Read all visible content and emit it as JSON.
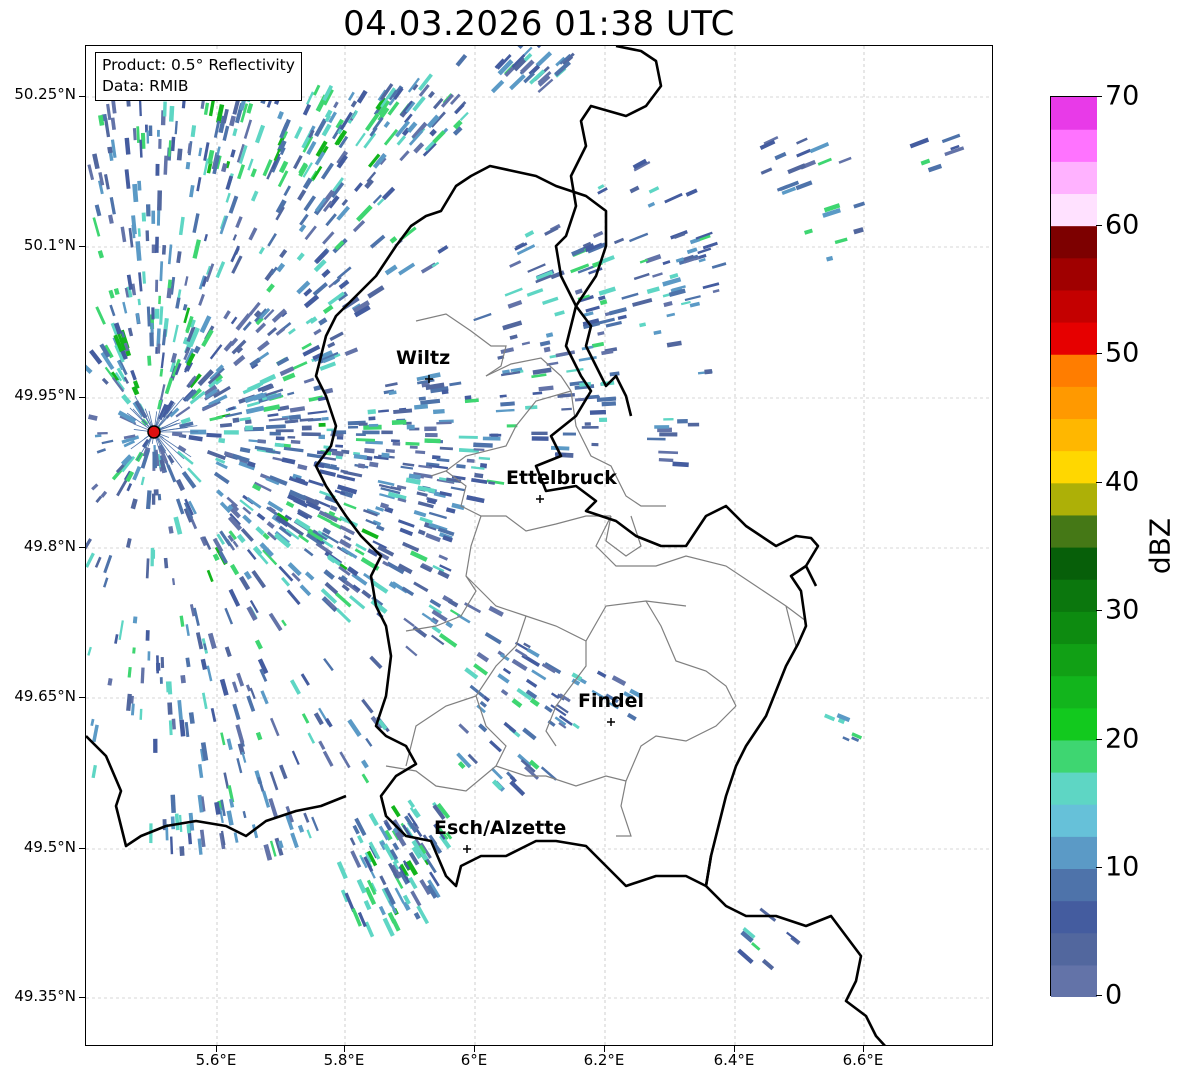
{
  "title": "04.03.2026 01:38 UTC",
  "info": {
    "product": "Product: 0.5° Reflectivity",
    "data": "Data: RMIB"
  },
  "axes": {
    "lat_labels": [
      "50.25°N",
      "50.1°N",
      "49.95°N",
      "49.8°N",
      "49.65°N",
      "49.5°N",
      "49.35°N"
    ],
    "lon_labels": [
      "5.6°E",
      "5.8°E",
      "6°E",
      "6.2°E",
      "6.4°E",
      "6.6°E"
    ]
  },
  "cities": [
    {
      "name": "Wiltz"
    },
    {
      "name": "Ettelbruck"
    },
    {
      "name": "Findel"
    },
    {
      "name": "Esch/Alzette"
    }
  ],
  "colorbar": {
    "unit": "dBZ",
    "tick_labels": [
      "70",
      "60",
      "50",
      "40",
      "30",
      "20",
      "10",
      "0"
    ],
    "colors": [
      "#6373a8",
      "#52679e",
      "#445c9f",
      "#4e73aa",
      "#5b9ac6",
      "#66c1d9",
      "#5ed6c4",
      "#3ed671",
      "#12c91e",
      "#12b51c",
      "#11a015",
      "#0d8b10",
      "#0b770d",
      "#075f09",
      "#457816",
      "#adb007",
      "#ffd700",
      "#ffb700",
      "#ff9900",
      "#ff7d00",
      "#e60000",
      "#c40000",
      "#a00000",
      "#7d0000",
      "#ffe1ff",
      "#ffb2ff",
      "#ff73ff",
      "#e83ae8"
    ]
  },
  "colors": {
    "border_national": "#000000",
    "border_district": "#808080",
    "radar_site": "#e01010",
    "grid": "#b0b0b0"
  }
}
